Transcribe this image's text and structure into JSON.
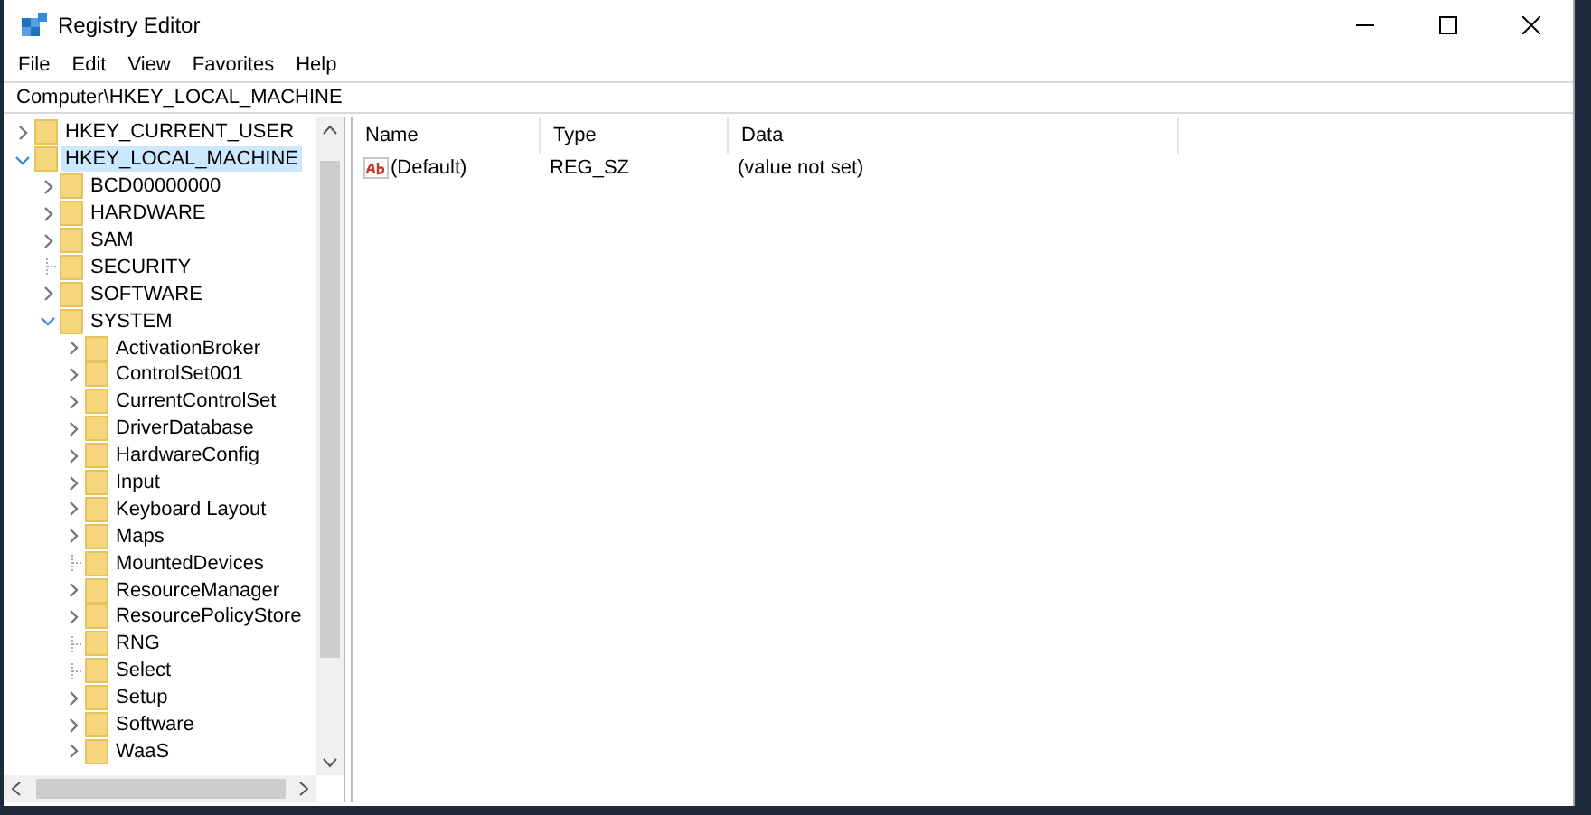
{
  "window": {
    "title": "Registry Editor"
  },
  "menu": [
    "File",
    "Edit",
    "View",
    "Favorites",
    "Help"
  ],
  "address": "Computer\\HKEY_LOCAL_MACHINE",
  "tree": [
    {
      "label": "HKEY_CURRENT_USER",
      "kind": "branch",
      "expanded": false,
      "selected": false
    },
    {
      "label": "HKEY_LOCAL_MACHINE",
      "kind": "branch",
      "expanded": true,
      "selected": true,
      "children": [
        {
          "label": "BCD00000000",
          "kind": "branch",
          "expanded": false,
          "selected": false
        },
        {
          "label": "HARDWARE",
          "kind": "branch",
          "expanded": false,
          "selected": false
        },
        {
          "label": "SAM",
          "kind": "branch",
          "expanded": false,
          "selected": false
        },
        {
          "label": "SECURITY",
          "kind": "leaf",
          "selected": false
        },
        {
          "label": "SOFTWARE",
          "kind": "branch",
          "expanded": false,
          "selected": false
        },
        {
          "label": "SYSTEM",
          "kind": "branch",
          "expanded": true,
          "selected": false,
          "children": [
            {
              "label": "ActivationBroker",
              "kind": "branch",
              "expanded": false,
              "selected": false
            },
            {
              "label": "ControlSet001",
              "kind": "branch",
              "expanded": false,
              "selected": false
            },
            {
              "label": "CurrentControlSet",
              "kind": "branch",
              "expanded": false,
              "selected": false
            },
            {
              "label": "DriverDatabase",
              "kind": "branch",
              "expanded": false,
              "selected": false
            },
            {
              "label": "HardwareConfig",
              "kind": "branch",
              "expanded": false,
              "selected": false
            },
            {
              "label": "Input",
              "kind": "branch",
              "expanded": false,
              "selected": false
            },
            {
              "label": "Keyboard Layout",
              "kind": "branch",
              "expanded": false,
              "selected": false
            },
            {
              "label": "Maps",
              "kind": "branch",
              "expanded": false,
              "selected": false
            },
            {
              "label": "MountedDevices",
              "kind": "leaf",
              "selected": false
            },
            {
              "label": "ResourceManager",
              "kind": "branch",
              "expanded": false,
              "selected": false
            },
            {
              "label": "ResourcePolicyStore",
              "kind": "branch",
              "expanded": false,
              "selected": false
            },
            {
              "label": "RNG",
              "kind": "leaf",
              "selected": false
            },
            {
              "label": "Select",
              "kind": "leaf",
              "selected": false
            },
            {
              "label": "Setup",
              "kind": "branch",
              "expanded": false,
              "selected": false
            },
            {
              "label": "Software",
              "kind": "branch",
              "expanded": false,
              "selected": false
            },
            {
              "label": "WaaS",
              "kind": "branch",
              "expanded": false,
              "selected": false
            }
          ]
        }
      ]
    }
  ],
  "table": {
    "columns": [
      "Name",
      "Type",
      "Data"
    ],
    "rows": [
      {
        "name": "(Default)",
        "type": "REG_SZ",
        "data": "(value not set)"
      }
    ]
  }
}
